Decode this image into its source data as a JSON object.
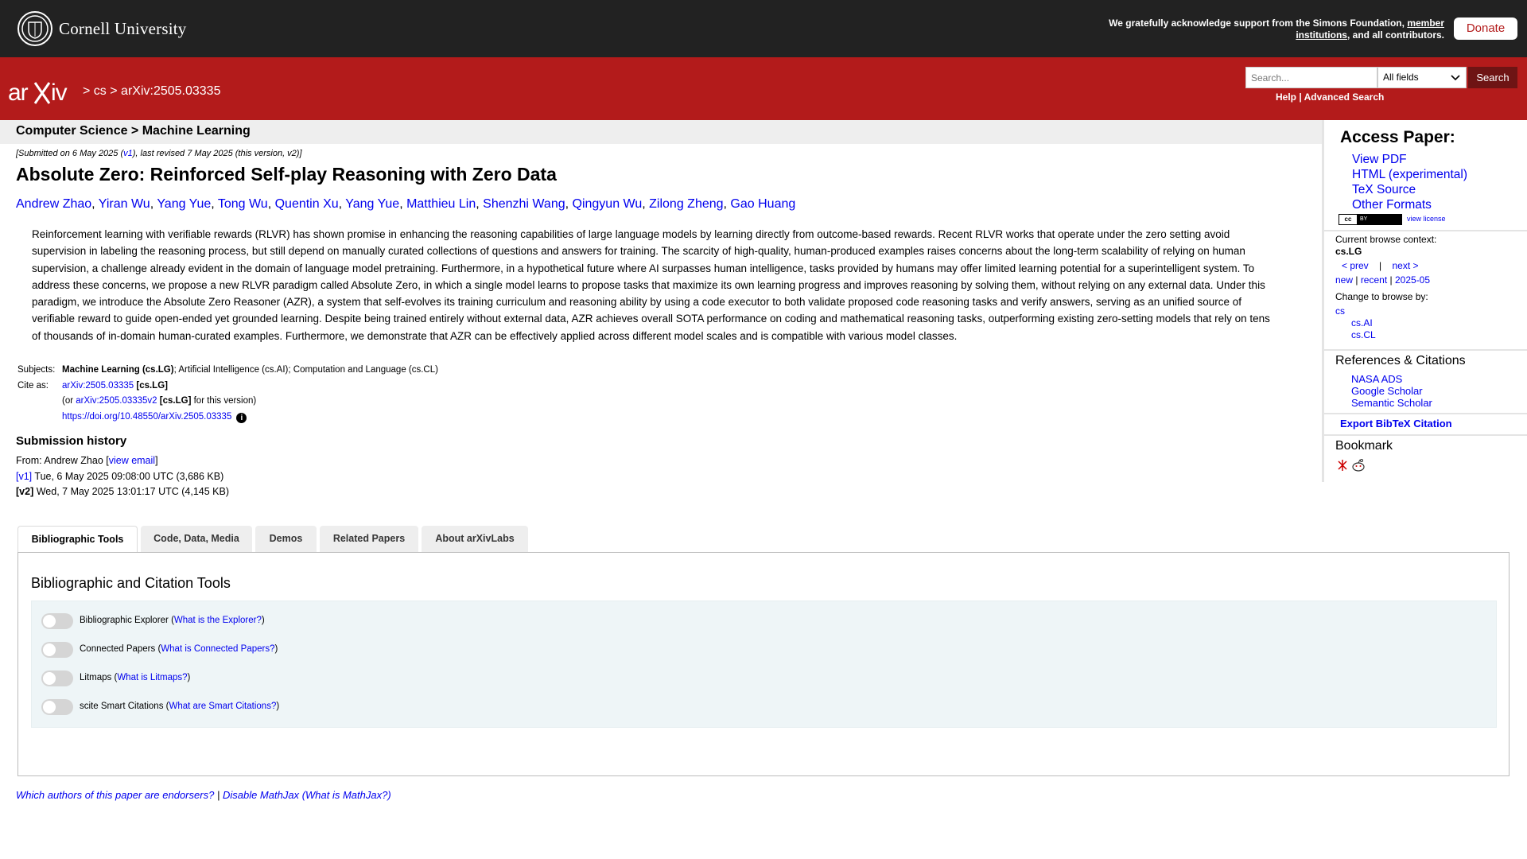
{
  "cornell": {
    "name": "Cornell University",
    "support_text": "We gratefully acknowledge support from the Simons Foundation,",
    "support_link": "member institutions",
    "support_tail": ", and all contributors.",
    "donate": "Donate"
  },
  "header": {
    "logo": "arXiv",
    "crumb_sep1": ">",
    "crumb_cs": "cs",
    "crumb_sep2": ">",
    "crumb_id": "arXiv:2505.03335",
    "search_placeholder": "Search...",
    "field_select": "All fields",
    "search_button": "Search",
    "help": "Help",
    "advanced": "Advanced Search"
  },
  "category": "Computer Science > Machine Learning",
  "paper": {
    "dateline_pre": "[Submitted on 6 May 2025 (",
    "dateline_v1": "v1",
    "dateline_post": "), last revised 7 May 2025 (this version, v2)]",
    "title": "Absolute Zero: Reinforced Self-play Reasoning with Zero Data",
    "authors": [
      "Andrew Zhao",
      "Yiran Wu",
      "Yang Yue",
      "Tong Wu",
      "Quentin Xu",
      "Yang Yue",
      "Matthieu Lin",
      "Shenzhi Wang",
      "Qingyun Wu",
      "Zilong Zheng",
      "Gao Huang"
    ],
    "abstract_lines": [
      "Reinforcement learning with verifiable rewards (RLVR) has shown promise in enhancing the reasoning capabilities of large language models by learning directly from outcome-based rewards. Recent RLVR works that operate under the zero setting avoid",
      "supervision in labeling the reasoning process, but still depend on manually curated collections of questions and answers for training. The scarcity of high-quality, human-produced examples raises concerns about the long-term scalability of relying on human",
      "supervision, a challenge already evident in the domain of language model pretraining. Furthermore, in a hypothetical future where AI surpasses human intelligence, tasks provided by humans may offer limited learning potential for a superintelligent system. To",
      "address these concerns, we propose a new RLVR paradigm called Absolute Zero, in which a single model learns to propose tasks that maximize its own learning progress and improves reasoning by solving them, without relying on any external data. Under this",
      "paradigm, we introduce the Absolute Zero Reasoner (AZR), a system that self-evolves its training curriculum and reasoning ability by using a code executor to both validate proposed code reasoning tasks and verify answers, serving as an unified source of",
      "verifiable reward to guide open-ended yet grounded learning. Despite being trained entirely without external data, AZR achieves overall SOTA performance on coding and mathematical reasoning tasks, outperforming existing zero-setting models that rely on tens",
      "of thousands of in-domain human-curated examples. Furthermore, we demonstrate that AZR can be effectively applied across different model scales and is compatible with various model classes."
    ],
    "subjects_label": "Subjects:",
    "subjects_primary": "Machine Learning (cs.LG)",
    "subjects_rest": "; Artificial Intelligence (cs.AI); Computation and Language (cs.CL)",
    "cite_label": "Cite as:",
    "cite_id": "arXiv:2505.03335",
    "cite_cat": "[cs.LG]",
    "cite2_pre": "(or",
    "cite2_id": "arXiv:2505.03335v2",
    "cite2_cat": "[cs.LG]",
    "cite2_post": "for this version)",
    "doi": "https://doi.org/10.48550/arXiv.2505.03335",
    "info_icon": "info-icon"
  },
  "history": {
    "title": "Submission history",
    "from_pre": "From: Andrew Zhao [",
    "from_link": "view email",
    "from_post": "]",
    "v1_label": "[v1]",
    "v1_text": "Tue, 6 May 2025 09:08:00 UTC (3,686 KB)",
    "v2_label": "[v2]",
    "v2_text": "Wed, 7 May 2025 13:01:17 UTC (4,145 KB)"
  },
  "tabs": [
    "Bibliographic Tools",
    "Code, Data, Media",
    "Demos",
    "Related Papers",
    "About arXivLabs"
  ],
  "tools": {
    "title": "Bibliographic and Citation Tools",
    "items": [
      {
        "label": "Bibliographic Explorer",
        "help": "What is the Explorer?"
      },
      {
        "label": "Connected Papers",
        "help": "What is Connected Papers?"
      },
      {
        "label": "Litmaps",
        "help": "What is Litmaps?"
      },
      {
        "label": "scite Smart Citations",
        "help": "What are Smart Citations?"
      }
    ]
  },
  "footer": {
    "endorsers": "Which authors of this paper are endorsers?",
    "sep": "|",
    "mathjax": "Disable MathJax",
    "mathjax_help": "(What is MathJax?)"
  },
  "sidebar": {
    "access_title": "Access Paper:",
    "access_links": [
      "View PDF",
      "HTML (experimental)",
      "TeX Source",
      "Other Formats"
    ],
    "license_badge": "cc BY",
    "view_license": "view license",
    "browse_context_label": "Current browse context:",
    "browse_context": "cs.LG",
    "prev": "< prev",
    "pipe": "|",
    "next": "next >",
    "new": "new",
    "recent": "recent",
    "date": "2025-05",
    "change_label": "Change to browse by:",
    "change_cs": "cs",
    "change_ai": "cs.AI",
    "change_cl": "cs.CL",
    "refs_title": "References & Citations",
    "refs": [
      "NASA ADS",
      "Google Scholar",
      "Semantic Scholar"
    ],
    "export": "Export BibTeX Citation",
    "bookmark": "Bookmark"
  }
}
